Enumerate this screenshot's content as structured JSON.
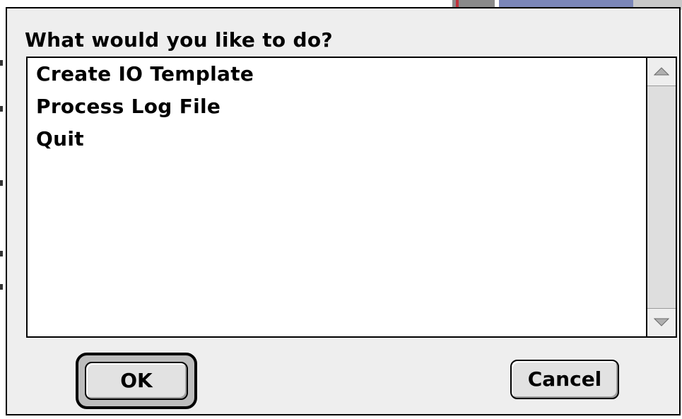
{
  "dialog": {
    "prompt": "What would you like to do?",
    "options": [
      {
        "label": "Create IO Template"
      },
      {
        "label": "Process Log File"
      },
      {
        "label": "Quit"
      }
    ],
    "ok_label": "OK",
    "cancel_label": "Cancel"
  },
  "icons": {
    "scroll_up": "triangle-up-icon",
    "scroll_down": "triangle-down-icon"
  },
  "colors": {
    "dialog_background": "#eeeeee",
    "list_background": "#ffffff",
    "background_window_title": "#7b86b8"
  }
}
